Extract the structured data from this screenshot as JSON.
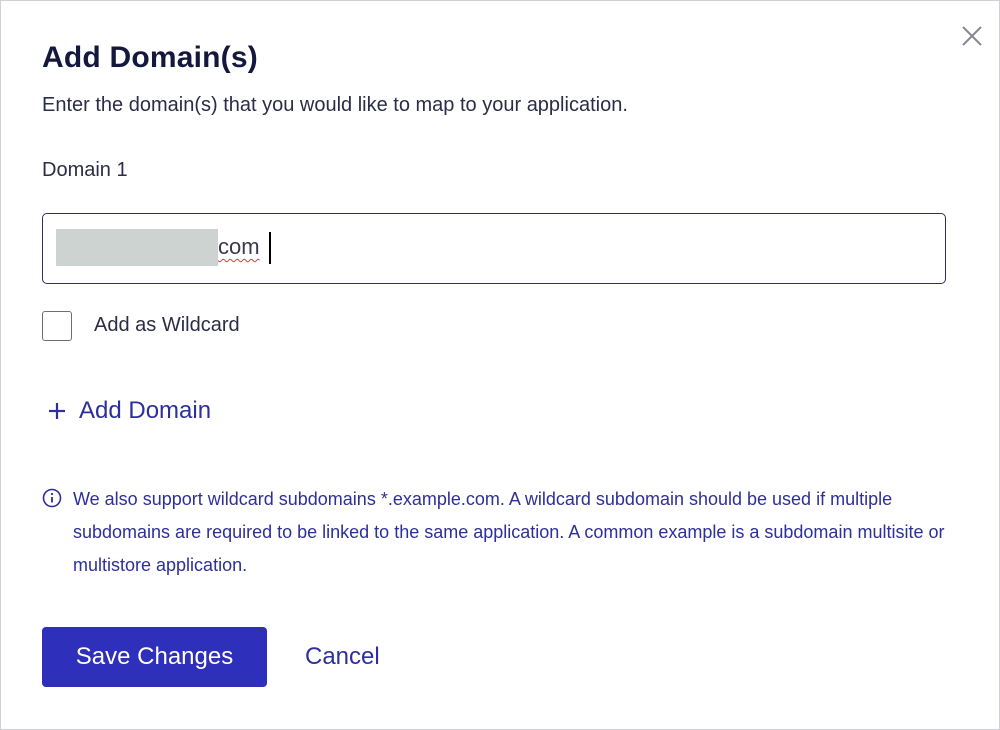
{
  "dialog": {
    "title": "Add Domain(s)",
    "subtitle": "Enter the domain(s) that you would like to map to your application.",
    "close_icon": "close-icon"
  },
  "domain_field": {
    "label": "Domain 1",
    "value": "com"
  },
  "wildcard": {
    "label": "Add as Wildcard",
    "checked": false
  },
  "add_domain": {
    "icon": "plus-icon",
    "label": "Add Domain"
  },
  "info": {
    "icon": "info-icon",
    "text": "We also support wildcard subdomains *.example.com. A wildcard subdomain should be used if multiple subdomains are required to be linked to the same application. A common example is a subdomain multisite or multistore application."
  },
  "actions": {
    "save_label": "Save Changes",
    "cancel_label": "Cancel"
  },
  "colors": {
    "accent": "#2e2fba",
    "link": "#2d2f9a",
    "title": "#14183d"
  }
}
